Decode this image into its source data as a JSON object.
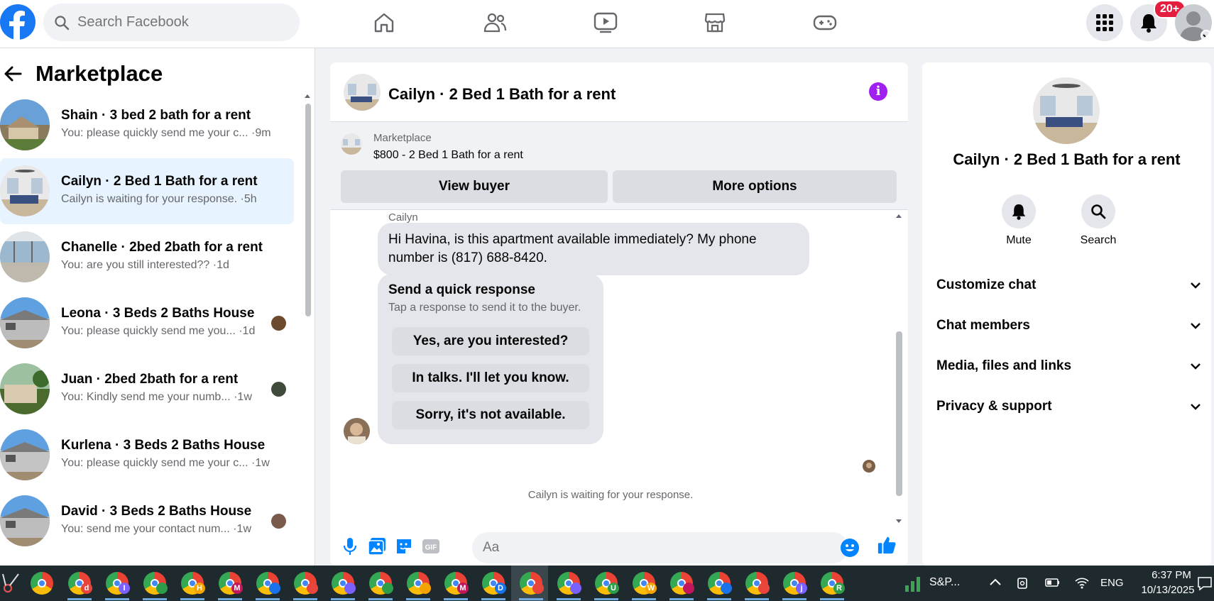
{
  "topbar": {
    "search_placeholder": "Search Facebook",
    "notification_count": "20+",
    "nav_icons": [
      "home-icon",
      "friends-icon",
      "watch-icon",
      "marketplace-icon",
      "gaming-icon"
    ]
  },
  "sidebar": {
    "title": "Marketplace",
    "threads": [
      {
        "title": "Shain · 3 bed 2 bath for a rent",
        "preview": "You: please quickly send me your c... ·9m"
      },
      {
        "title": "Cailyn · 2 Bed 1 Bath for a rent",
        "preview": "Cailyn is waiting for your response. ·5h"
      },
      {
        "title": "Chanelle · 2bed 2bath for a rent",
        "preview": "You: are you still interested?? ·1d"
      },
      {
        "title": "Leona · 3 Beds 2 Baths House",
        "preview": "You: please quickly send me you... ·1d"
      },
      {
        "title": "Juan · 2bed 2bath for a rent",
        "preview": "You: Kindly send me your numb... ·1w"
      },
      {
        "title": "Kurlena · 3 Beds 2 Baths House",
        "preview": "You: please quickly send me your c... ·1w"
      },
      {
        "title": "David · 3 Beds 2 Baths House",
        "preview": "You: send me your contact num... ·1w"
      }
    ]
  },
  "chat": {
    "title": "Cailyn · 2 Bed 1 Bath for a rent",
    "marketplace_label": "Marketplace",
    "listing": "$800 - 2 Bed 1 Bath for a rent",
    "view_buyer": "View buyer",
    "more_options": "More options",
    "sender": "Cailyn",
    "message": "Hi Havina, is this apartment available immediately? My phone number is (817) 688-8420.",
    "quick_title": "Send a quick response",
    "quick_sub": "Tap a response to send it to the buyer.",
    "quick_options": [
      "Yes, are you interested?",
      "In talks. I'll let you know.",
      "Sorry, it's not available."
    ],
    "waiting": "Cailyn is waiting for your response.",
    "input_placeholder": "Aa"
  },
  "details": {
    "name": "Cailyn · 2 Bed 1 Bath for a rent",
    "mute": "Mute",
    "search": "Search",
    "sections": [
      "Customize chat",
      "Chat members",
      "Media, files and links",
      "Privacy & support"
    ]
  },
  "taskbar": {
    "app_letters": [
      "B",
      "d",
      "I",
      "",
      "H",
      "M",
      "",
      "",
      "",
      "",
      "",
      "M",
      "D",
      "",
      "",
      "U",
      "W",
      "",
      "",
      "",
      "j",
      "R"
    ],
    "stock": "S&P...",
    "lang": "ENG",
    "time": "6:37 PM",
    "date": "10/13/2025"
  },
  "colors": {
    "accent": "#1877f2",
    "active_thread": "#e7f3ff",
    "info_icon": "#a020f0",
    "badge": "#e41e3f"
  }
}
